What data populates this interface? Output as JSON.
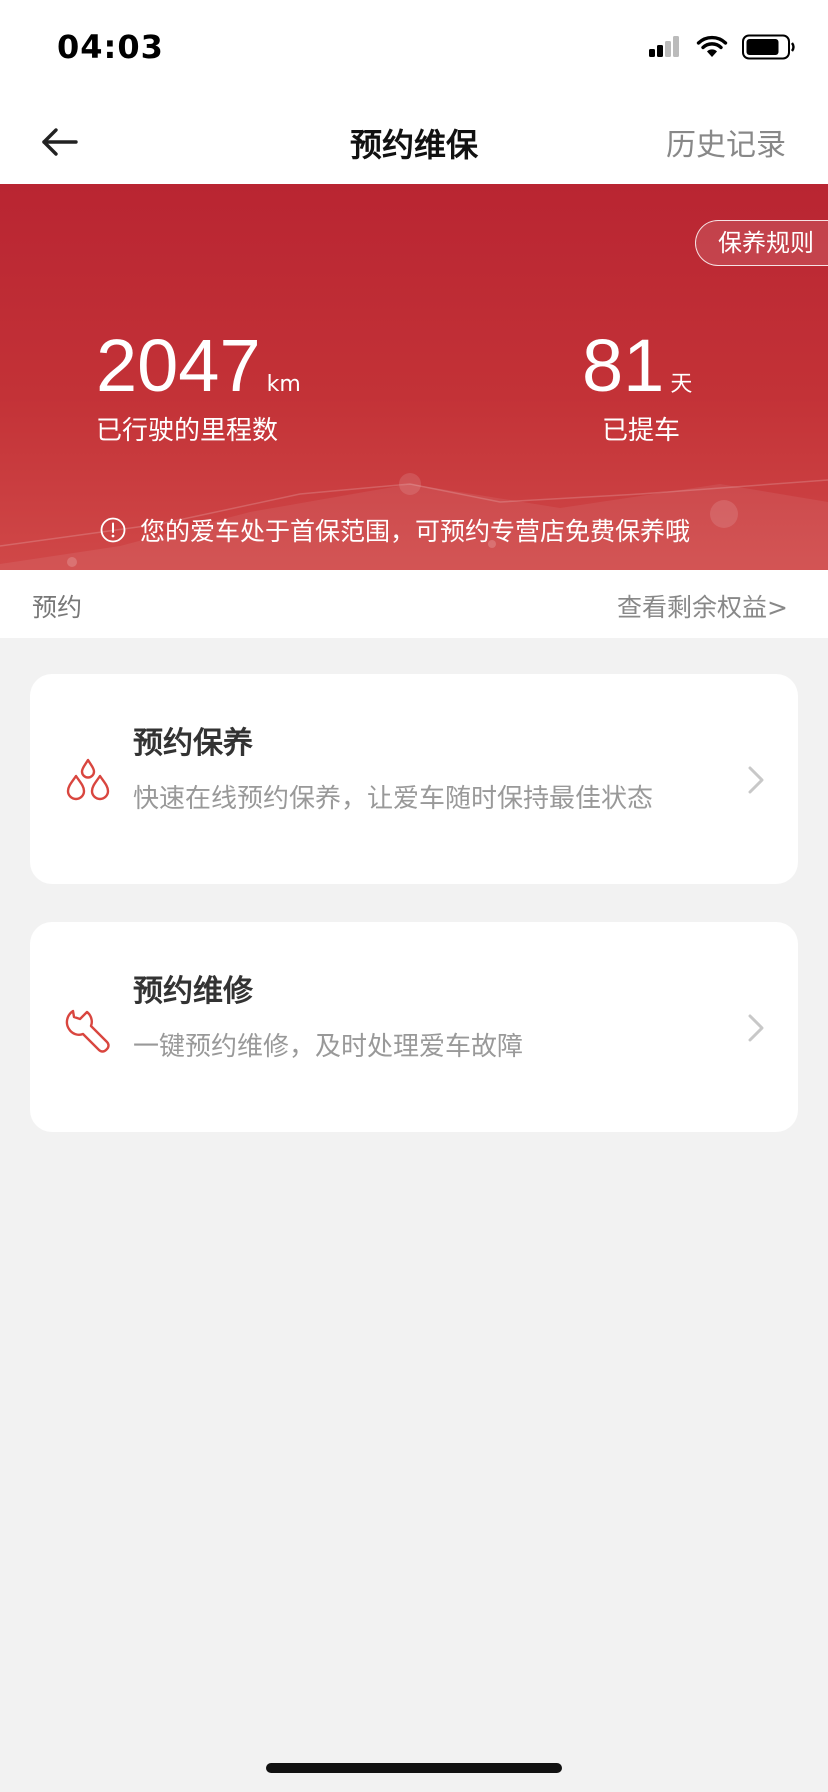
{
  "status_bar": {
    "time": "04:03",
    "icons": [
      "signal-icon",
      "wifi-icon",
      "battery-icon"
    ]
  },
  "nav": {
    "title": "预约维保",
    "history_label": "历史记录",
    "back_icon": "back-arrow-icon"
  },
  "hero": {
    "rules_label": "保养规则",
    "mileage": {
      "value": "2047",
      "unit": "km",
      "label": "已行驶的里程数"
    },
    "days": {
      "value": "81",
      "unit": "天",
      "label": "已提车"
    },
    "notice": "您的爱车处于首保范围，可预约专营店免费保养哦",
    "notice_icon": "alert-circle-icon"
  },
  "section": {
    "label": "预约",
    "benefits_link": "查看剩余权益>"
  },
  "services": [
    {
      "title": "预约保养",
      "description": "快速在线预约保养，让爱车随时保持最佳状态",
      "icon": "oil-drops-icon"
    },
    {
      "title": "预约维修",
      "description": "一键预约维修，及时处理爱车故障",
      "icon": "wrench-icon"
    }
  ],
  "colors": {
    "brand_red": "#c02b35",
    "icon_red": "#d9463f",
    "page_bg": "#f2f2f2"
  }
}
